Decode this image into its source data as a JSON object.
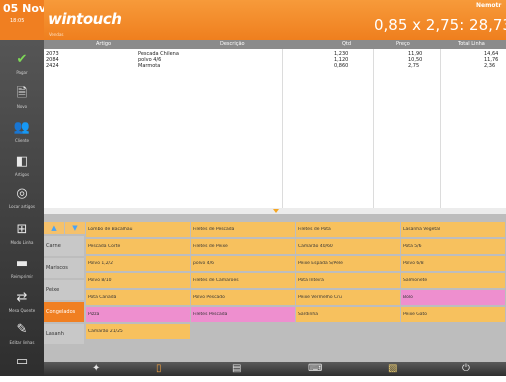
{
  "sidebar": {
    "date": "05 Nov",
    "time": "18:05",
    "buttons": [
      {
        "icon": "check-icon",
        "label": "Pagar"
      },
      {
        "icon": "new-doc-icon",
        "label": "Novo"
      },
      {
        "icon": "client-icon",
        "label": "Cliente"
      },
      {
        "icon": "article-icon",
        "label": "Artigos"
      },
      {
        "icon": "search-icon",
        "label": "Locar artigos"
      },
      {
        "icon": "discount-icon",
        "label": "Modo Linha"
      },
      {
        "icon": "print-icon",
        "label": "Reimprimir"
      },
      {
        "icon": "transfer-icon",
        "label": "Mesa Quente"
      },
      {
        "icon": "edit-icon",
        "label": "Editar linhas"
      },
      {
        "icon": "window-icon",
        "label": ""
      }
    ]
  },
  "header": {
    "logo": "wintouch",
    "logo_sub": "Vendas",
    "user": "Nemotr",
    "formula": "0,85 x 2,75:  28,73"
  },
  "table": {
    "columns": [
      "Artigo",
      "Descrição",
      "Qtd",
      "Preço",
      "Total Linha"
    ],
    "rows": [
      {
        "artigo": "2073",
        "descricao": "Pescada Chilena",
        "qtd": "1,230",
        "preco": "11,90",
        "total": "14,64"
      },
      {
        "artigo": "2084",
        "descricao": "polvo 4/6",
        "qtd": "1,120",
        "preco": "10,50",
        "total": "11,76"
      },
      {
        "artigo": "2424",
        "descricao": "Marmota",
        "qtd": "0,860",
        "preco": "2,75",
        "total": "2,36"
      }
    ]
  },
  "categories": [
    "Carne",
    "Mariscos",
    "Peixe",
    "Congelados",
    "Lasanh"
  ],
  "selected_category": "Congelados",
  "nav": {
    "up": "▲",
    "down": "▼"
  },
  "products": [
    [
      "Lombo de Bacalhau",
      "Filetes de Pescada",
      "Filetes de Pota",
      "Lasanha Vegetal"
    ],
    [
      "Pescada Corte",
      "Filetes de Peixe",
      "Camarão 40/60",
      "Pota 5/6"
    ],
    [
      "Polvo 1,2/2",
      "polvo 4/6",
      "Peixe Espada S/Pele",
      "Polvo 6/8"
    ],
    [
      "Polvo 8/10",
      "Filetes de Camarões",
      "Pota Inteira",
      "Salmonete"
    ],
    [
      "Pota Canadá",
      "Polvo Pescado",
      "Peixe Vermelho Cru",
      "Bolo"
    ],
    [
      "Pizza",
      "Filetes Pescada",
      "Sardinha",
      "Peixe Gato"
    ],
    [
      "Camarão 21/25",
      "",
      "",
      ""
    ]
  ],
  "pink_products": [
    "Bolo",
    "Pizza",
    "Filetes Pescada"
  ],
  "toolbar": [
    "magic-icon",
    "receipt-icon",
    "cash-icon",
    "keyboard-icon",
    "document-icon",
    "power-icon"
  ],
  "colors": {
    "accent": "#f07f21",
    "product": "#f7c15e",
    "special": "#ee8fcf"
  }
}
